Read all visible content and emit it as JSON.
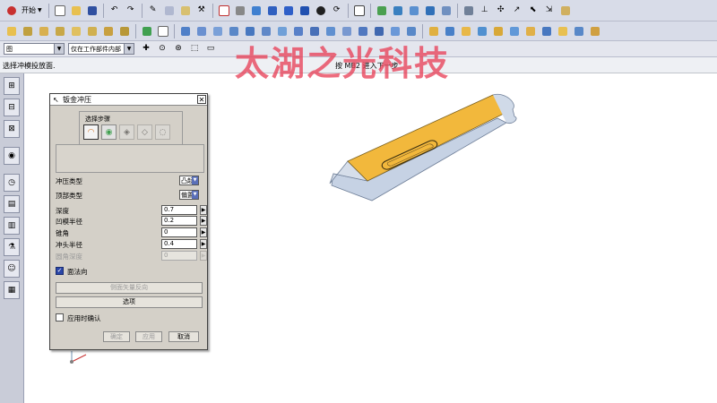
{
  "toolbar": {
    "start_label": "开始",
    "wcs_combo": "图",
    "filter_combo": "仅在工作部件内部"
  },
  "status": {
    "prompt": "选择冲模投放面.",
    "center": "按 MB2 进入下一步"
  },
  "watermark": "太湖之光科技",
  "dialog": {
    "title": "钣金冲压",
    "steps_label": "选择步骤",
    "punch_type_label": "冲压类型",
    "punch_type_value": "凸起",
    "top_type_label": "顶部类型",
    "top_type_value": "偏置",
    "depth_label": "深度",
    "depth_value": "0.7",
    "die_radius_label": "凹模半径",
    "die_radius_value": "0.2",
    "taper_label": "锥角",
    "taper_value": "0",
    "punch_radius_label": "冲头半径",
    "punch_radius_value": "0.4",
    "corner_depth_label": "圆角深度",
    "corner_depth_value": "0",
    "face_normal_label": "面法向",
    "reverse_btn": "侧面矢量反向",
    "options_btn": "选项",
    "confirm_label": "应用时确认",
    "ok_btn": "确定",
    "apply_btn": "应用",
    "cancel_btn": "取消"
  },
  "colors": {
    "toolbar_bg": "#d8dce8",
    "part_top": "#f2b83c",
    "part_side": "#c6d2e4",
    "watermark": "#e8435a",
    "checkbox": "#2a46a8"
  }
}
